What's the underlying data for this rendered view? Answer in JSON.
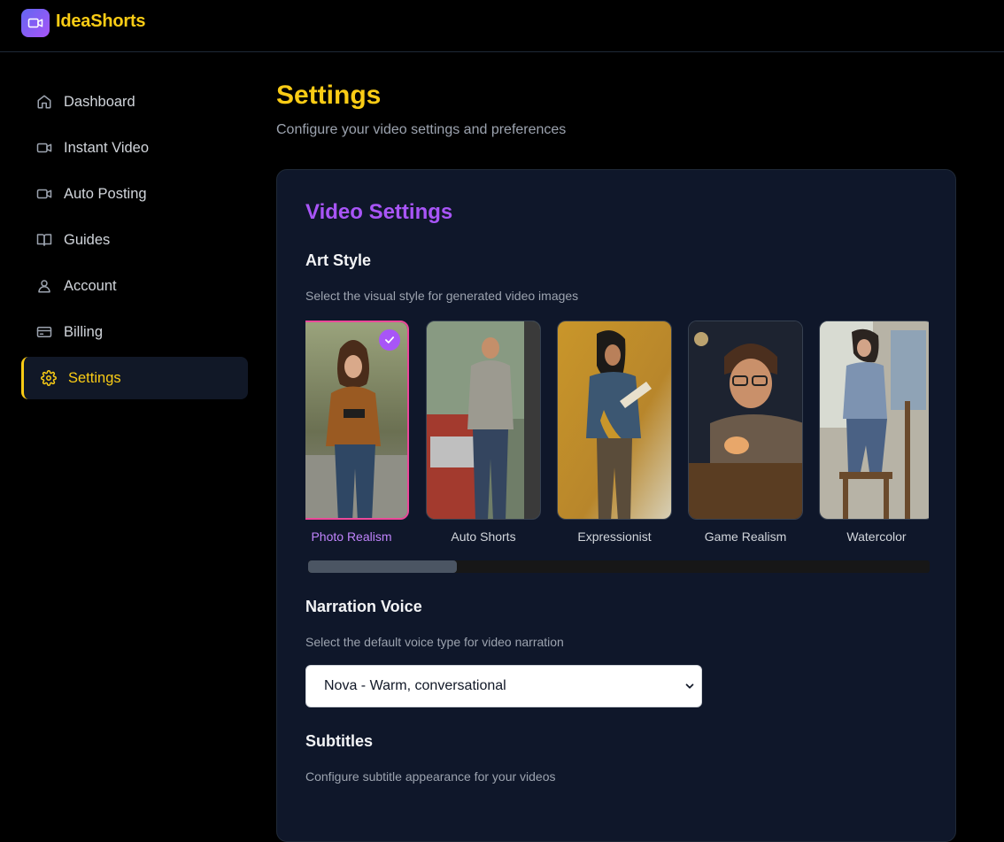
{
  "app": {
    "name": "IdeaShorts"
  },
  "sidebar": {
    "items": [
      {
        "label": "Dashboard",
        "icon": "home-icon"
      },
      {
        "label": "Instant Video",
        "icon": "video-icon"
      },
      {
        "label": "Auto Posting",
        "icon": "video-icon"
      },
      {
        "label": "Guides",
        "icon": "book-icon"
      },
      {
        "label": "Account",
        "icon": "user-icon"
      },
      {
        "label": "Billing",
        "icon": "credit-card-icon"
      },
      {
        "label": "Settings",
        "icon": "gear-icon",
        "active": true
      }
    ]
  },
  "page": {
    "title": "Settings",
    "subtitle": "Configure your video settings and preferences"
  },
  "video_settings": {
    "title": "Video Settings",
    "art_style": {
      "title": "Art Style",
      "description": "Select the visual style for generated video images",
      "selected": "Photo Realism",
      "options": [
        {
          "label": "Photo Realism"
        },
        {
          "label": "Auto Shorts"
        },
        {
          "label": "Expressionist"
        },
        {
          "label": "Game Realism"
        },
        {
          "label": "Watercolor"
        }
      ]
    },
    "narration": {
      "title": "Narration Voice",
      "description": "Select the default voice type for video narration",
      "selected_value": "Nova - Warm, conversational"
    },
    "subtitles": {
      "title": "Subtitles",
      "description": "Configure subtitle appearance for your videos"
    }
  },
  "colors": {
    "accent": "#facc15",
    "brand_purple": "#a855f7",
    "selected_border": "#ec4899",
    "background": "#000000",
    "card": "#0f172a"
  }
}
